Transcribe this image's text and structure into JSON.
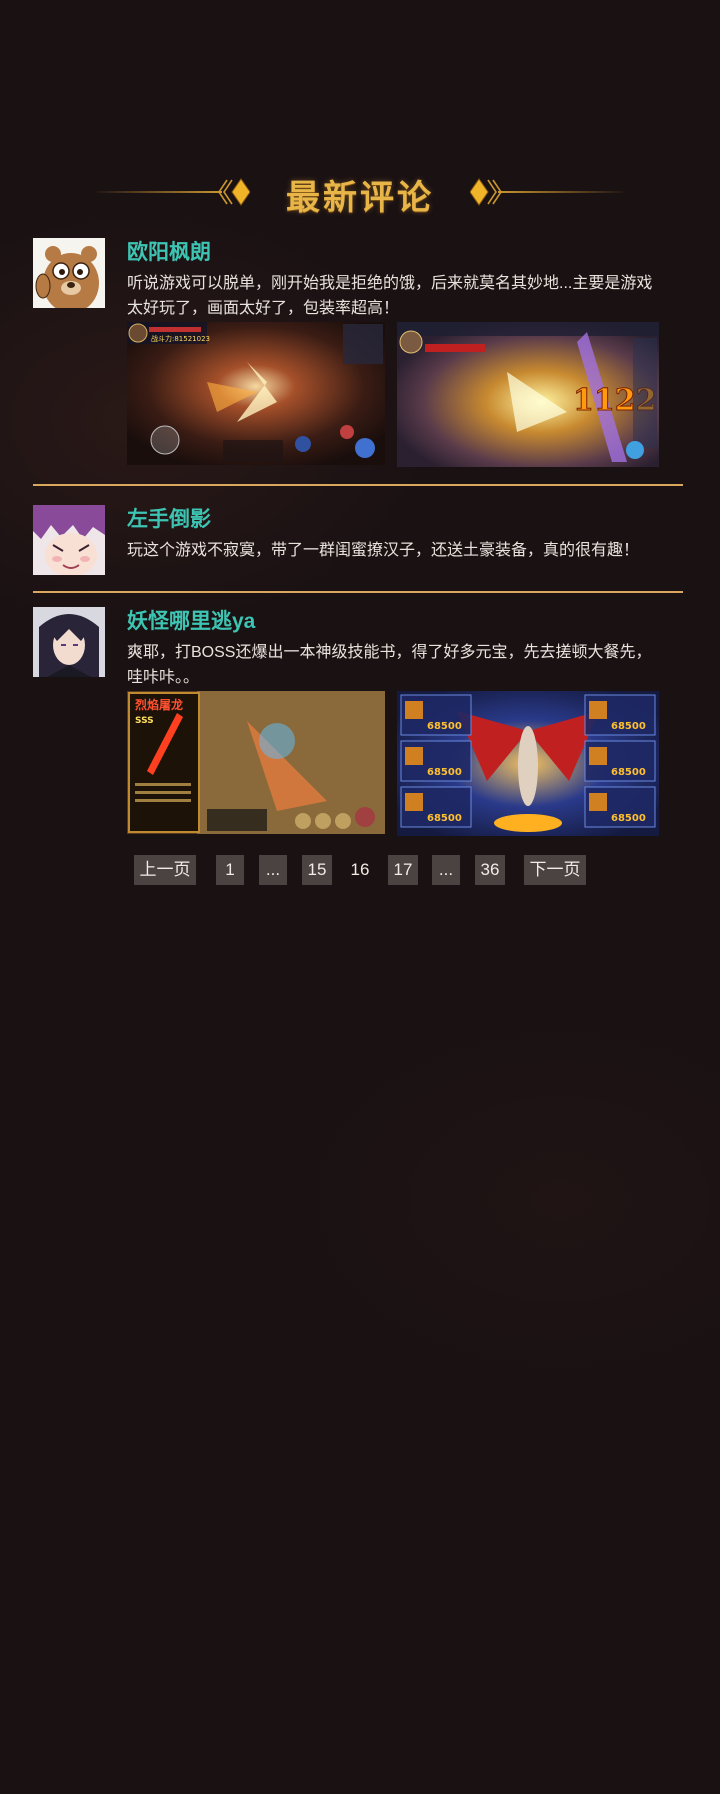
{
  "section": {
    "title": "最新评论"
  },
  "comments": [
    {
      "user": "欧阳枫朗",
      "text": "听说游戏可以脱单，刚开始我是拒绝的饿，后来就莫名其妙地...主要是游戏\n太好玩了，画面太好了，包装率超高！",
      "avatar_icon": "cartoon-bear-avatar",
      "screenshots": [
        {
          "hud_text": "战斗力:81521023"
        },
        {
          "damage_text": "1122"
        }
      ]
    },
    {
      "user": "左手倒影",
      "text": "玩这个游戏不寂寞，带了一群闺蜜撩汉子，还送土豪装备，真的很有趣！",
      "avatar_icon": "anime-purple-hair-avatar"
    },
    {
      "user": "妖怪哪里逃ya",
      "text": "爽耶，打BOSS还爆出一本神级技能书，得了好多元宝，先去搓顿大餐先，\n哇咔咔。。",
      "avatar_icon": "anime-dark-hair-avatar",
      "screenshots": [
        {
          "panel_title": "烈焰屠龙",
          "grade": "SSS"
        },
        {
          "power_values": [
            "68500",
            "68500",
            "68500",
            "68500",
            "68500",
            "68500"
          ]
        }
      ]
    }
  ],
  "pagination": {
    "prev": "上一页",
    "first": "1",
    "ellipsis1": "...",
    "p15": "15",
    "current": "16",
    "p17": "17",
    "ellipsis2": "...",
    "last": "36",
    "next": "下一页"
  },
  "colors": {
    "background": "#1a1113",
    "title_gold": "#e8b548",
    "username_teal": "#3dc4b2",
    "divider": "#d9a85e",
    "page_button": "#4b4242"
  }
}
